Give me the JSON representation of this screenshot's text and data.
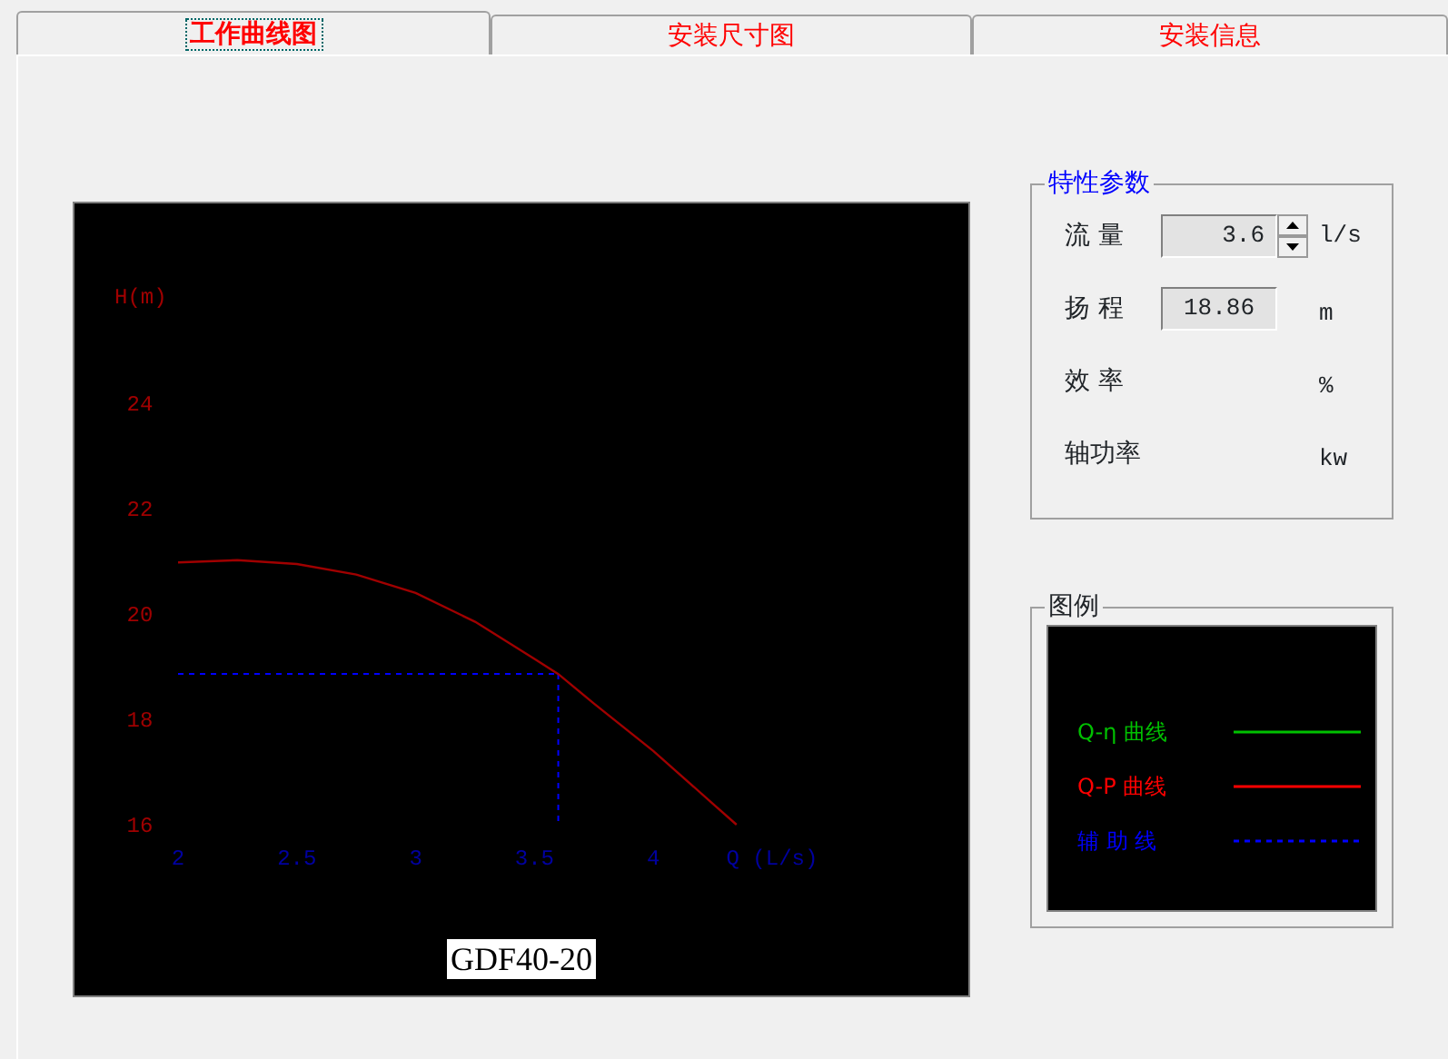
{
  "tabs": [
    {
      "label": "工作曲线图",
      "selected": true
    },
    {
      "label": "安装尺寸图",
      "selected": false
    },
    {
      "label": "安装信息",
      "selected": false
    }
  ],
  "curve_panel": {
    "chart_data": {
      "type": "line",
      "title": "GDF40-20",
      "ylabel": "H(m)",
      "xlim": [
        2,
        4.5
      ],
      "ylim": [
        16,
        24
      ],
      "xticks": [
        2,
        2.5,
        3,
        3.5,
        4,
        {
          "value": 4.5,
          "label": "Q (L/s)"
        }
      ],
      "yticks": [
        16,
        18,
        20,
        22,
        24
      ],
      "x": [
        2,
        2.25,
        2.5,
        2.75,
        3,
        3.25,
        3.5,
        3.6,
        3.75,
        4,
        4.25,
        4.35
      ],
      "series": [
        {
          "color": "#a00000",
          "values": [
            20.98,
            21.02,
            20.95,
            20.75,
            20.4,
            19.85,
            19.15,
            18.86,
            18.3,
            17.4,
            16.4,
            16.0
          ]
        }
      ],
      "ref_lines": [
        {
          "axis": "y",
          "value": 18.86
        },
        {
          "axis": "x",
          "value": 3.6
        }
      ]
    }
  },
  "parameters": {
    "title": "特性参数",
    "rows": [
      {
        "kind": "spin",
        "label": "流 量",
        "value": "3.6",
        "unit": "l/s"
      },
      {
        "kind": "field",
        "label": "扬 程",
        "value": "18.86",
        "unit": "m"
      },
      {
        "kind": "none",
        "label": "效 率",
        "unit": "%"
      },
      {
        "kind": "none",
        "label": "轴功率",
        "unit": "kw"
      }
    ]
  },
  "legend": {
    "title": "图例",
    "items": [
      {
        "label": "Q-η 曲线",
        "color": "#00c000",
        "kind": "solid"
      },
      {
        "label": "Q-P 曲线",
        "color": "#ff0000",
        "kind": "solid"
      },
      {
        "label": "辅 助 线",
        "color": "#0000ff",
        "kind": "dashed"
      }
    ]
  }
}
